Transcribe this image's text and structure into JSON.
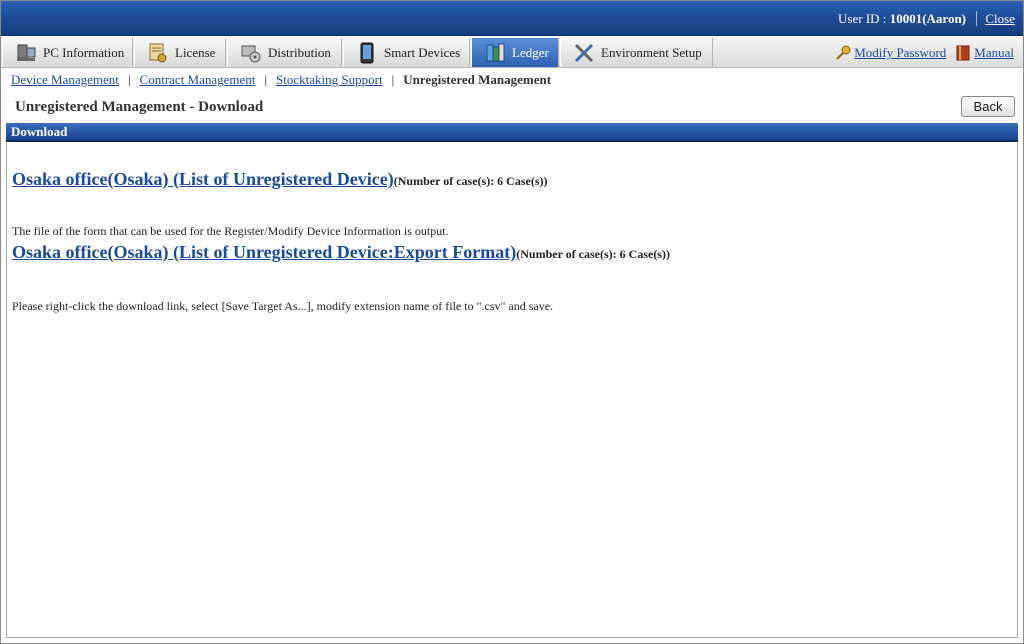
{
  "header": {
    "user_label": "User ID : ",
    "user_value": "10001(Aaron)",
    "close_label": "Close"
  },
  "tabs": [
    {
      "label": "PC Information",
      "icon": "pc-icon"
    },
    {
      "label": "License",
      "icon": "license-icon"
    },
    {
      "label": "Distribution",
      "icon": "distribution-icon"
    },
    {
      "label": "Smart Devices",
      "icon": "smartphone-icon"
    },
    {
      "label": "Ledger",
      "icon": "ledger-icon",
      "active": true
    },
    {
      "label": "Environment Setup",
      "icon": "tools-icon"
    }
  ],
  "right_links": {
    "modify_password": "Modify Password",
    "manual": "Manual"
  },
  "breadcrumbs": {
    "items": [
      "Device Management",
      "Contract Management",
      "Stocktaking Support"
    ],
    "current": "Unregistered Management"
  },
  "page": {
    "title": "Unregistered Management - Download",
    "back_label": "Back",
    "section_title": "Download"
  },
  "downloads": [
    {
      "link": "Osaka office(Osaka)  (List of Unregistered Device)",
      "count": "(Number of case(s): 6 Case(s))"
    },
    {
      "link": "Osaka office(Osaka)  (List of Unregistered Device:Export Format)",
      "count": "(Number of case(s): 6 Case(s))"
    }
  ],
  "notes": {
    "export_note": "The file of the form that can be used for the Register/Modify Device Information is output.",
    "instruction": "Please right-click the download link, select [Save Target As...], modify extension name of file to \".csv\" and save."
  },
  "colors": {
    "header_blue": "#1f4f9c",
    "link_blue": "#1a4aa0",
    "active_tab": "#2e62b4"
  }
}
